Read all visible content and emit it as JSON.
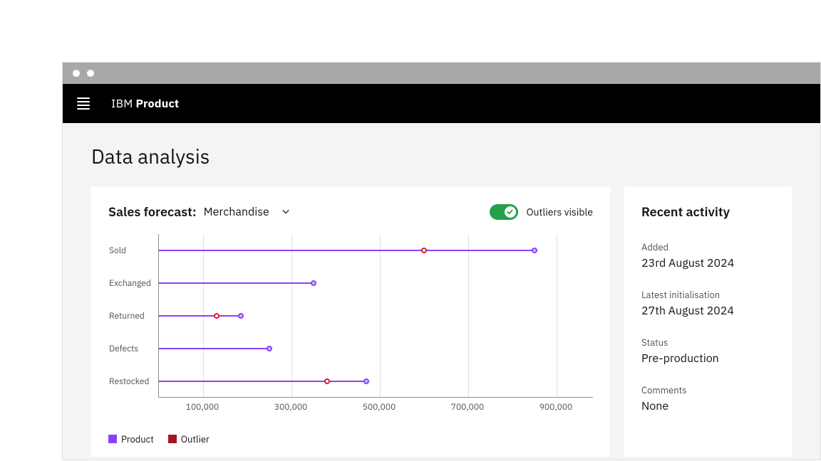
{
  "brand": {
    "prefix": "IBM",
    "name": "Product"
  },
  "page": {
    "title": "Data analysis"
  },
  "forecast": {
    "title": "Sales forecast:",
    "selected": "Merchandise",
    "toggle_label": "Outliers visible",
    "toggle_on": true
  },
  "chart_data": {
    "type": "bar",
    "categories": [
      "Sold",
      "Exchanged",
      "Returned",
      "Defects",
      "Restocked"
    ],
    "series": [
      {
        "name": "Product",
        "color": "#8a3ffc",
        "values": [
          850000,
          350000,
          185000,
          250000,
          470000
        ]
      },
      {
        "name": "Outlier",
        "color": "#a2191f",
        "values": [
          600000,
          null,
          130000,
          null,
          380000
        ]
      }
    ],
    "xlabel": "",
    "ylabel": "",
    "xlim": [
      0,
      1000000
    ],
    "xticks": [
      100000,
      300000,
      500000,
      700000,
      900000
    ],
    "xtick_labels": [
      "100,000",
      "300,000",
      "500,000",
      "700,000",
      "900,000"
    ],
    "legend": [
      "Product",
      "Outlier"
    ]
  },
  "recent": {
    "title": "Recent activity",
    "fields": [
      {
        "label": "Added",
        "value": "23rd August 2024"
      },
      {
        "label": "Latest initialisation",
        "value": "27th August 2024"
      },
      {
        "label": "Status",
        "value": "Pre-production"
      },
      {
        "label": "Comments",
        "value": "None"
      }
    ]
  }
}
